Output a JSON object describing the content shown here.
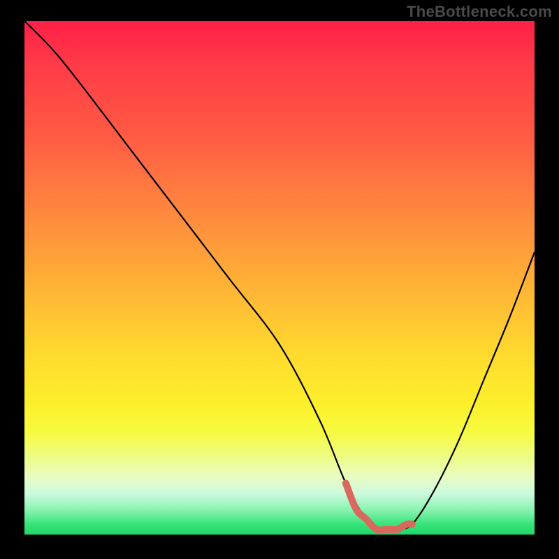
{
  "watermark": "TheBottleneck.com",
  "chart_data": {
    "type": "line",
    "title": "",
    "xlabel": "",
    "ylabel": "",
    "xlim": [
      0,
      100
    ],
    "ylim": [
      0,
      100
    ],
    "series": [
      {
        "name": "bottleneck-curve",
        "x": [
          0,
          5,
          10,
          20,
          30,
          40,
          50,
          58,
          63,
          67,
          70,
          73,
          76,
          80,
          85,
          90,
          95,
          100
        ],
        "values": [
          100,
          95,
          89,
          76,
          63,
          50,
          37,
          22,
          10,
          3,
          1,
          1,
          2,
          8,
          18,
          30,
          42,
          55
        ]
      }
    ],
    "highlight": {
      "name": "optimal-range",
      "color": "#d9695f",
      "x": [
        63,
        65,
        67,
        69,
        71,
        73,
        75,
        76
      ],
      "values": [
        10,
        5,
        3,
        1,
        1,
        1,
        2,
        2
      ]
    },
    "annotations": [],
    "grid": false,
    "legend": false
  }
}
